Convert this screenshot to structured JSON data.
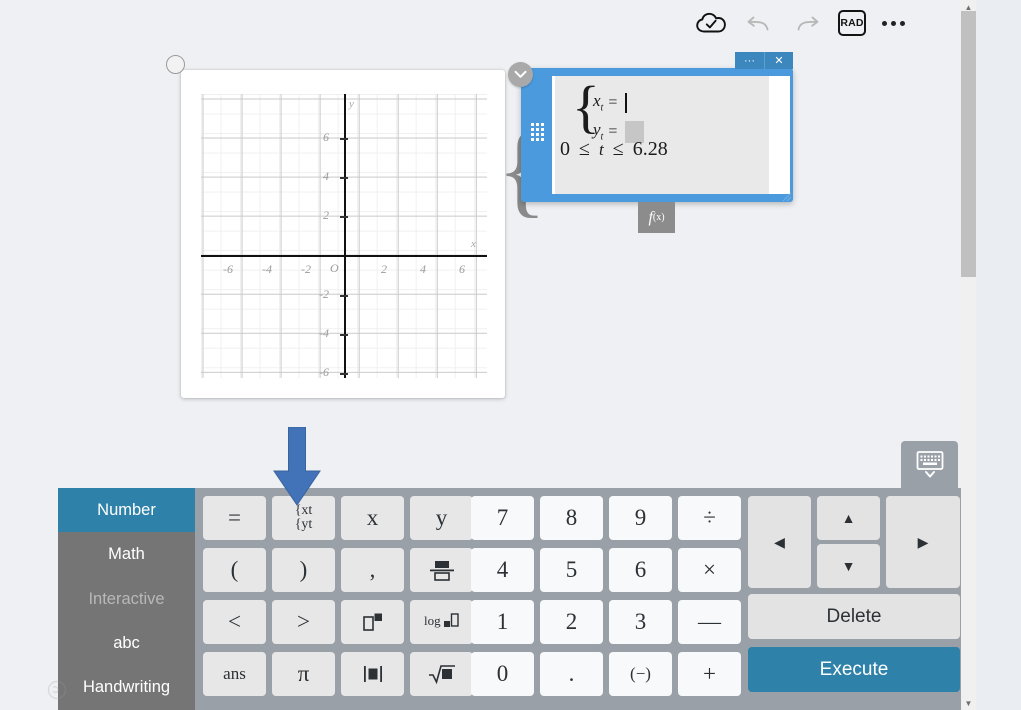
{
  "toolbar": {
    "save_icon": "cloud-check-icon",
    "undo_icon": "undo-icon",
    "redo_icon": "redo-icon",
    "angle_mode": "RAD",
    "more_icon": "more-options-icon"
  },
  "graph": {
    "title": "graph-card",
    "x_axis_label": "x",
    "y_axis_label": "y",
    "origin_label": "O",
    "x_ticks": [
      "-6",
      "-4",
      "-2",
      "2",
      "4",
      "6"
    ],
    "y_ticks": [
      "6",
      "4",
      "2",
      "-2",
      "-4",
      "-6"
    ]
  },
  "chart_data": {
    "type": "scatter",
    "title": "",
    "xlabel": "x",
    "ylabel": "y",
    "xlim": [
      -7.3,
      7.3
    ],
    "ylim": [
      -7.3,
      7.3
    ],
    "xticks": [
      -6,
      -4,
      -2,
      0,
      2,
      4,
      6
    ],
    "yticks": [
      -6,
      -4,
      -2,
      0,
      2,
      4,
      6
    ],
    "grid": true,
    "minor_grid": true,
    "series": [],
    "annotations": [
      "O"
    ]
  },
  "panel": {
    "name": "parametric-equation-editor",
    "more_label": "···",
    "close_label": "✕",
    "collapse_icon": "chevron-down-icon",
    "grip_icon": "drag-grip-icon",
    "equations": [
      {
        "var": "x",
        "sub": "t",
        "eq": "=",
        "value": "",
        "state": "caret"
      },
      {
        "var": "y",
        "sub": "t",
        "eq": "=",
        "value": "",
        "state": "placeholder"
      }
    ],
    "range": {
      "lower": "0",
      "rel1": "≤",
      "variable": "t",
      "rel2": "≤",
      "upper": "6.28"
    },
    "fx_label": "f",
    "fx_sub": "(x)"
  },
  "keyboard": {
    "tabs": [
      {
        "label": "Number",
        "state": "active"
      },
      {
        "label": "Math",
        "state": "normal"
      },
      {
        "label": "Interactive",
        "state": "disabled"
      },
      {
        "label": "abc",
        "state": "normal"
      },
      {
        "label": "Handwriting",
        "state": "normal"
      }
    ],
    "func_keys": [
      {
        "label": "=",
        "name": "key-equals",
        "style": "plain"
      },
      {
        "label": "{xt\n{yt",
        "name": "key-parametric",
        "style": "parametric"
      },
      {
        "label": "x",
        "name": "key-x",
        "style": "italic"
      },
      {
        "label": "y",
        "name": "key-y",
        "style": "italic"
      },
      {
        "label": "(",
        "name": "key-open-paren",
        "style": "plain"
      },
      {
        "label": ")",
        "name": "key-close-paren",
        "style": "plain"
      },
      {
        "label": ",",
        "name": "key-comma",
        "style": "plain"
      },
      {
        "label": "fraction",
        "name": "key-fraction",
        "style": "glyph"
      },
      {
        "label": "<",
        "name": "key-less-than",
        "style": "plain"
      },
      {
        "label": ">",
        "name": "key-greater-than",
        "style": "plain"
      },
      {
        "label": "power",
        "name": "key-power",
        "style": "glyph"
      },
      {
        "label": "log",
        "name": "key-logarithm",
        "style": "glyph"
      },
      {
        "label": "ans",
        "name": "key-ans",
        "style": "plain"
      },
      {
        "label": "π",
        "name": "key-pi",
        "style": "italic"
      },
      {
        "label": "abs",
        "name": "key-absolute-value",
        "style": "glyph"
      },
      {
        "label": "sqrt",
        "name": "key-square-root",
        "style": "glyph"
      }
    ],
    "num_keys": [
      {
        "label": "7",
        "name": "key-7"
      },
      {
        "label": "8",
        "name": "key-8"
      },
      {
        "label": "9",
        "name": "key-9"
      },
      {
        "label": "÷",
        "name": "key-divide"
      },
      {
        "label": "4",
        "name": "key-4"
      },
      {
        "label": "5",
        "name": "key-5"
      },
      {
        "label": "6",
        "name": "key-6"
      },
      {
        "label": "×",
        "name": "key-multiply"
      },
      {
        "label": "1",
        "name": "key-1"
      },
      {
        "label": "2",
        "name": "key-2"
      },
      {
        "label": "3",
        "name": "key-3"
      },
      {
        "label": "—",
        "name": "key-minus"
      },
      {
        "label": "0",
        "name": "key-0"
      },
      {
        "label": ".",
        "name": "key-decimal-point"
      },
      {
        "label": "(−)",
        "name": "key-negative-sign"
      },
      {
        "label": "+",
        "name": "key-plus"
      }
    ],
    "arrows": {
      "left": "◀",
      "up": "▲",
      "down": "▼",
      "right": "▶"
    },
    "delete_label": "Delete",
    "execute_label": "Execute",
    "toggle_icon": "keyboard-hide-icon"
  },
  "scrollbar": {
    "up_arrow": "▲",
    "down_arrow": "▼"
  },
  "colors": {
    "accent_blue": "#2e81a8",
    "panel_blue": "#4b9ade",
    "keyboard_gray": "#9aa0a8",
    "tab_gray": "#757575",
    "arrow_annotation": "#4272b8"
  }
}
